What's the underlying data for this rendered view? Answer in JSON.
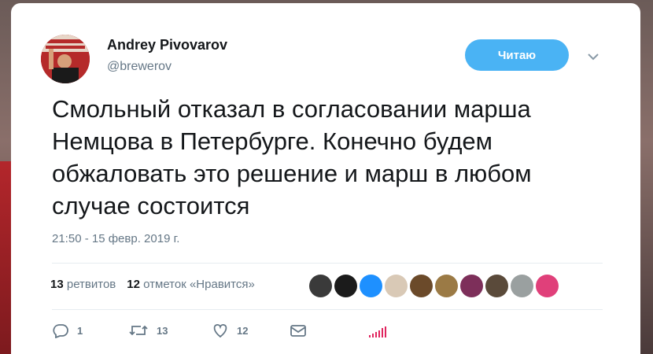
{
  "author": {
    "name": "Andrey Pivovarov",
    "handle": "@brewerov"
  },
  "follow_button_label": "Читаю",
  "tweet": {
    "lines": [
      "Смольный отказал в согласовании марша",
      "Немцова в Петербурге.  Конечно будем",
      "обжаловать это решение и марш в любом",
      "случае состоится"
    ],
    "timestamp": "21:50 - 15 февр. 2019 г."
  },
  "stats": {
    "retweets_count": "13",
    "retweets_label": "ретвитов",
    "likes_count": "12",
    "likes_label": "отметок «Нравится»"
  },
  "liker_avatars": [
    {
      "color": "#3a3a3a"
    },
    {
      "color": "#1b1b1b"
    },
    {
      "color": "#1e90ff"
    },
    {
      "color": "#d9c9b6"
    },
    {
      "color": "#6b4a2a"
    },
    {
      "color": "#9b7a45"
    },
    {
      "color": "#7d2f5a"
    },
    {
      "color": "#5a4a3a"
    },
    {
      "color": "#9aa0a0"
    },
    {
      "color": "#e0407a"
    }
  ],
  "actions": {
    "reply_count": "1",
    "retweet_count": "13",
    "like_count": "12"
  },
  "colors": {
    "accent": "#4ab3f4",
    "text": "#14171a",
    "muted": "#657786"
  }
}
